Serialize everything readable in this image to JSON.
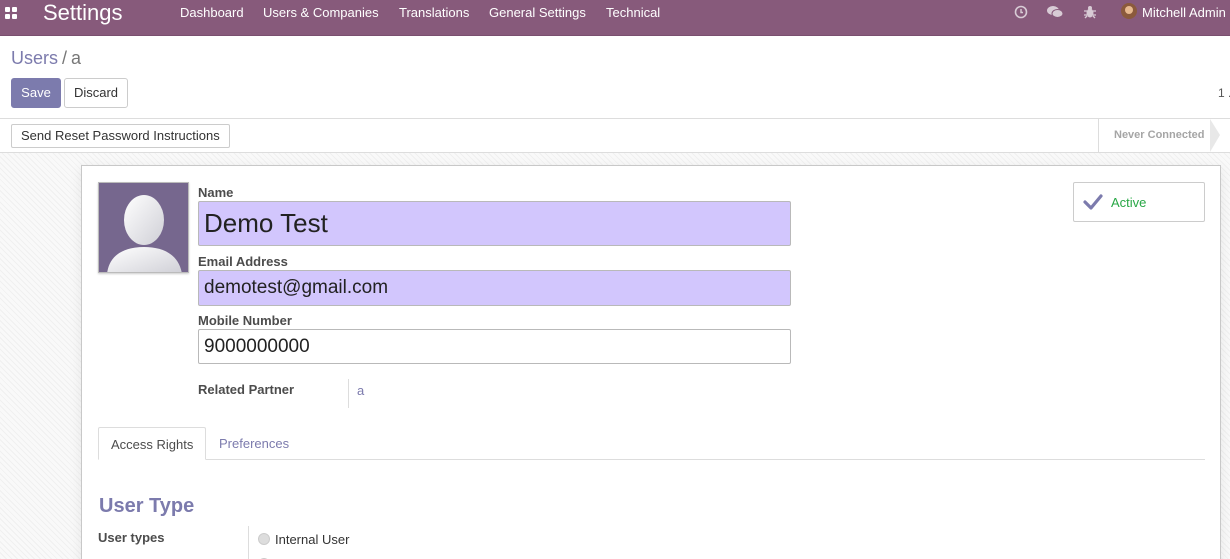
{
  "app": {
    "title": "Settings",
    "menu": [
      "Dashboard",
      "Users & Companies",
      "Translations",
      "General Settings",
      "Technical"
    ],
    "user": "Mitchell Admin",
    "systray_icons": [
      "clock-icon",
      "chat-icon",
      "bug-icon"
    ]
  },
  "breadcrumb": {
    "parent": "Users",
    "separator": "/",
    "current": "a"
  },
  "buttons": {
    "save": "Save",
    "discard": "Discard"
  },
  "pager": {
    "text": "1 ."
  },
  "statusbar": {
    "action": "Send Reset Password Instructions",
    "stage": "Never Connected"
  },
  "form": {
    "name_label": "Name",
    "name_value": "Demo Test",
    "email_label": "Email Address",
    "email_value": "demotest@gmail.com",
    "mobile_label": "Mobile Number",
    "mobile_value": "9000000000",
    "partner_label": "Related Partner",
    "partner_value": "a",
    "active_label": "Active"
  },
  "tabs": [
    "Access Rights",
    "Preferences"
  ],
  "access": {
    "section_title": "User Type",
    "user_types_label": "User types",
    "option_1": "Internal User"
  },
  "colors": {
    "navbar": "#875a7b",
    "accent": "#7c7bad",
    "required_field": "#d2c6fd",
    "active_green": "#28a745"
  }
}
